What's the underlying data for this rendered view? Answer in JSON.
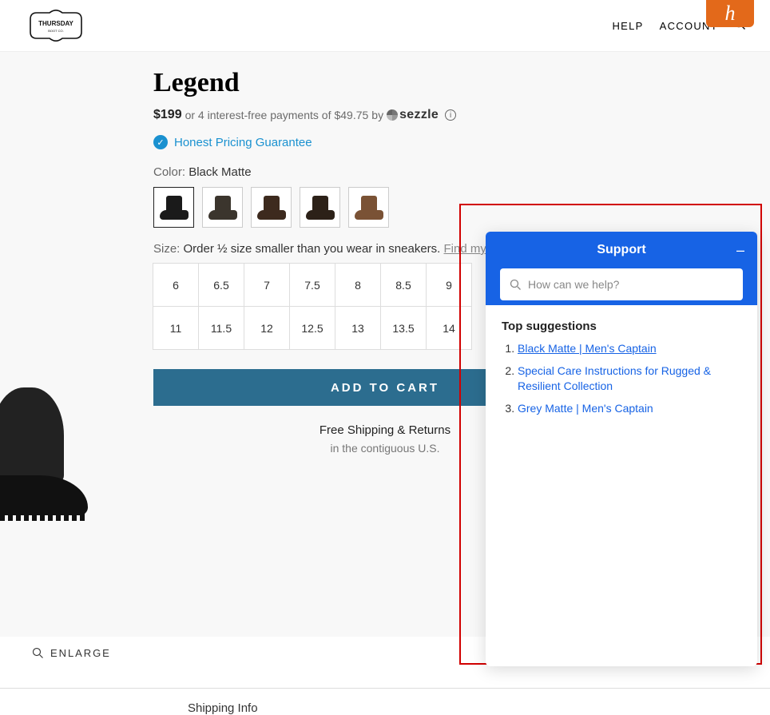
{
  "header": {
    "nav": {
      "help": "HELP",
      "account": "ACCOUNT"
    },
    "honey_badge": "h"
  },
  "product": {
    "title": "Legend",
    "price": "$199",
    "pay_later_prefix": "or 4 interest-free payments of ",
    "pay_later_amount": "$49.75",
    "pay_later_by": " by",
    "sezzle": "sezzle",
    "honest": "Honest Pricing Guarantee",
    "color_label": "Color: ",
    "color_value": "Black Matte",
    "swatches": [
      {
        "name": "black-matte",
        "selected": true
      },
      {
        "name": "dark-olive",
        "selected": false
      },
      {
        "name": "dark-brown",
        "selected": false
      },
      {
        "name": "espresso",
        "selected": false
      },
      {
        "name": "tan",
        "selected": false
      }
    ],
    "size_label": "Size: ",
    "size_hint": "Order ½ size smaller than you wear in sneakers. ",
    "size_link": "Find my size",
    "sizes": [
      "6",
      "6.5",
      "7",
      "7.5",
      "8",
      "8.5",
      "9",
      "",
      "",
      "",
      "11",
      "11.5",
      "12",
      "12.5",
      "13",
      "13.5",
      "14",
      "",
      "",
      ""
    ],
    "add_to_cart": "ADD TO CART",
    "free_ship_l1": "Free Shipping & Returns",
    "free_ship_l2": "in the contiguous U.S.",
    "enlarge": "ENLARGE"
  },
  "footer": {
    "shipping_info": "Shipping Info"
  },
  "support": {
    "title": "Support",
    "minimize": "–",
    "search_placeholder": "How can we help?",
    "top_suggestions_label": "Top suggestions",
    "suggestions": [
      "Black Matte | Men's Captain",
      "Special Care Instructions for Rugged & Resilient Collection",
      "Grey Matte | Men's Captain"
    ]
  }
}
